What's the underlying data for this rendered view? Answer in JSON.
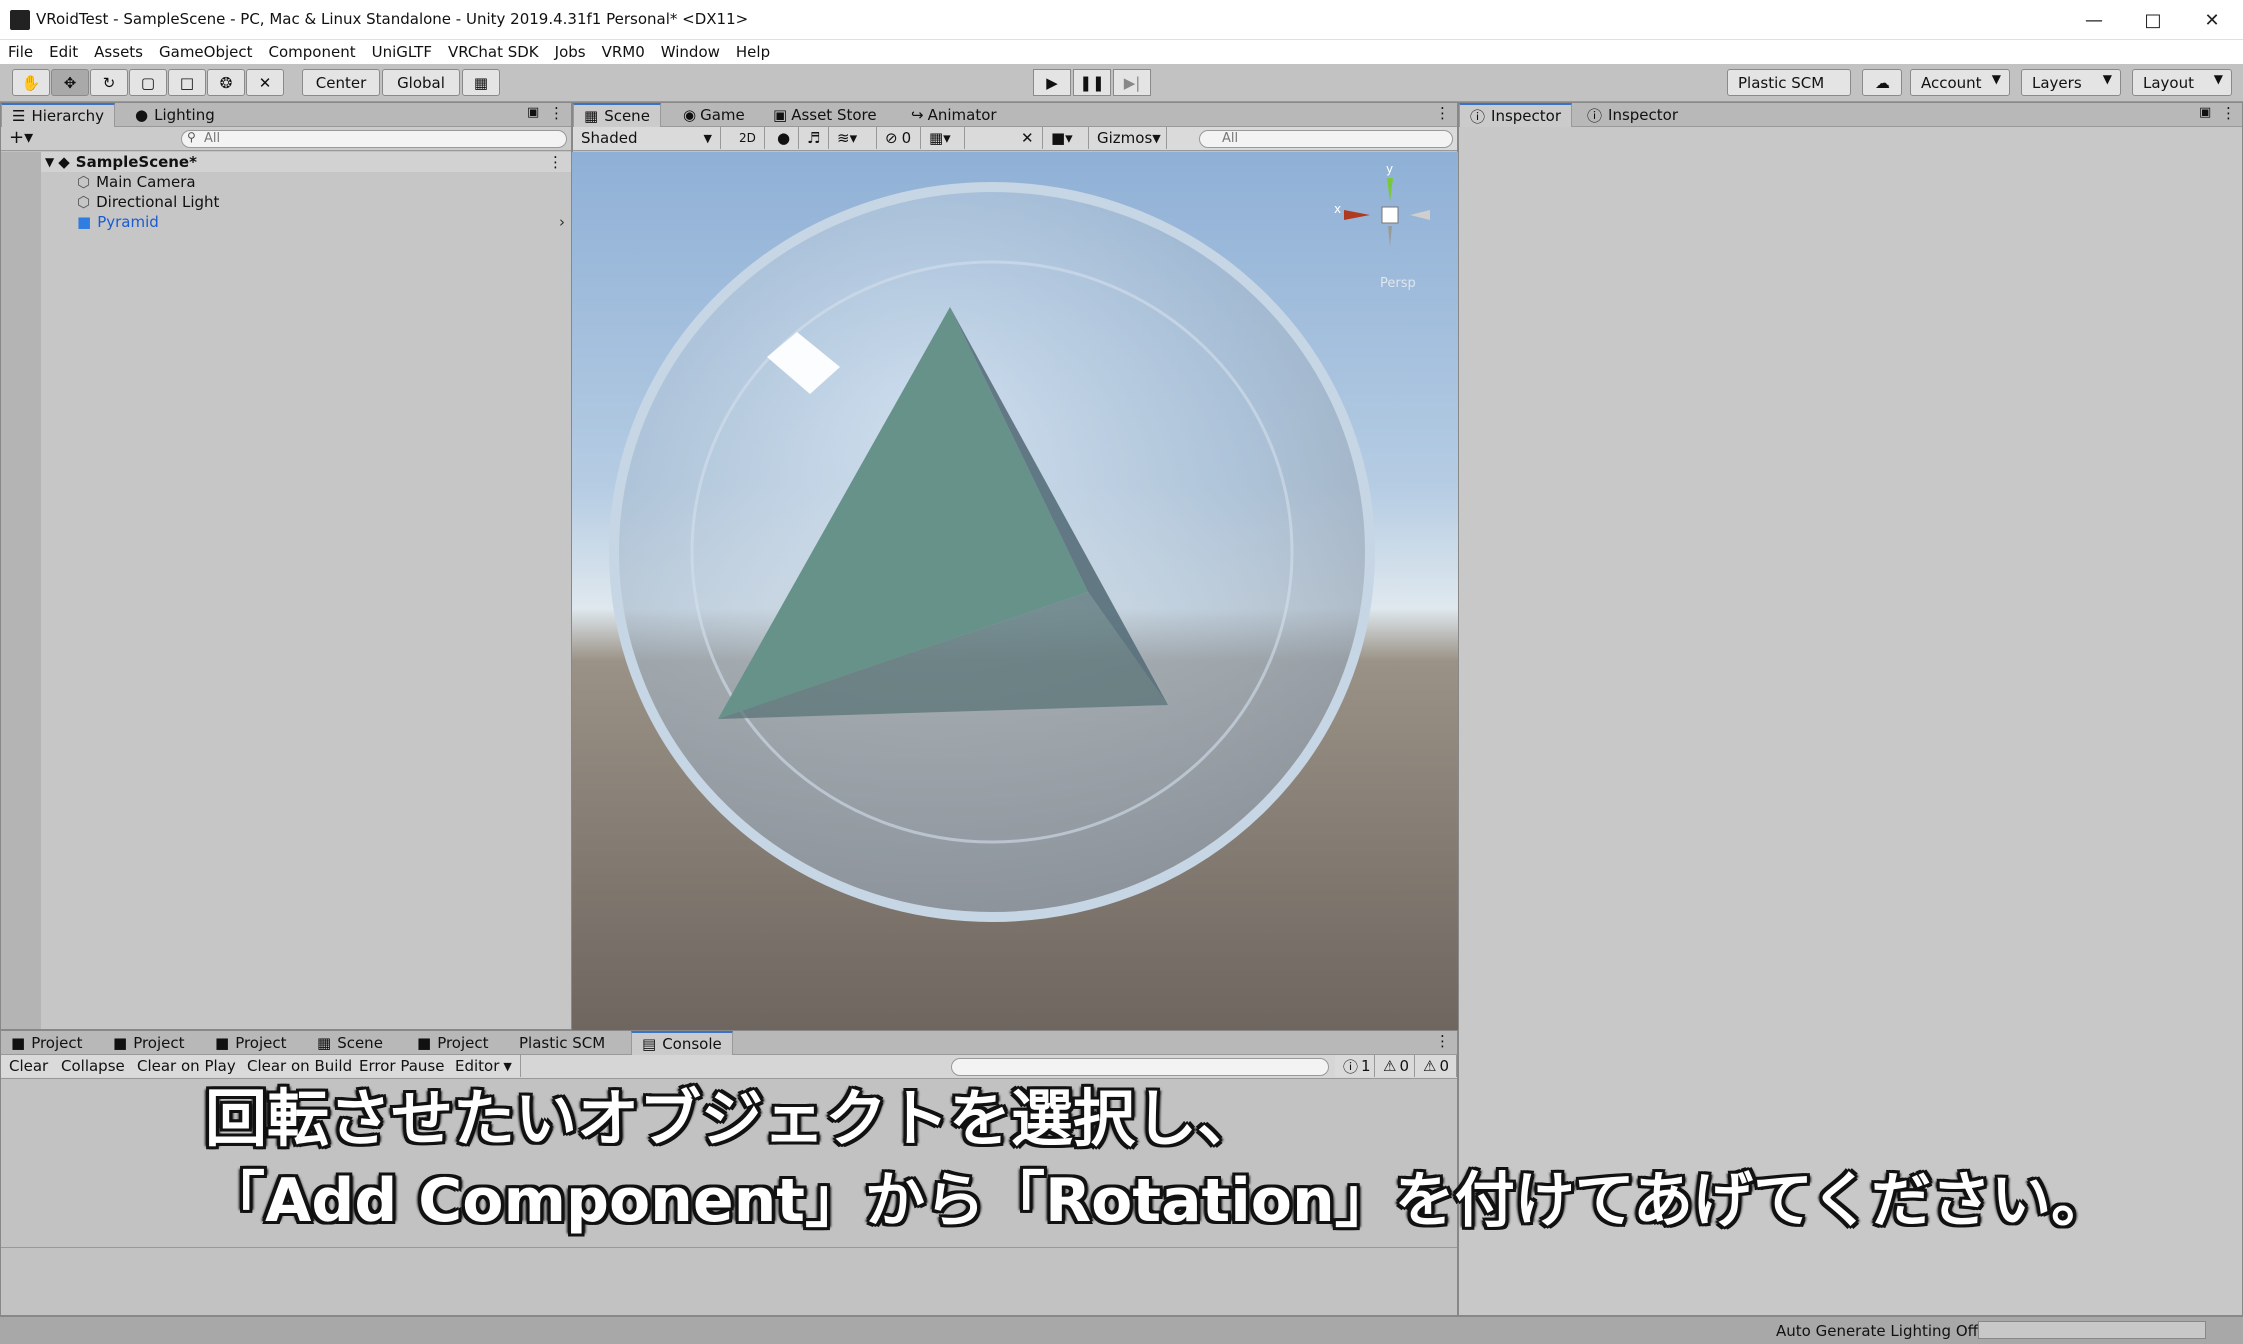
{
  "window": {
    "title": "VRoidTest - SampleScene - PC, Mac & Linux Standalone - Unity 2019.4.31f1 Personal* <DX11>"
  },
  "menu": [
    "File",
    "Edit",
    "Assets",
    "GameObject",
    "Component",
    "UniGLTF",
    "VRChat SDK",
    "Jobs",
    "VRM0",
    "Window",
    "Help"
  ],
  "toolbar": {
    "pivot_label": "Center",
    "space_label": "Global",
    "plastic_label": "Plastic SCM",
    "account_label": "Account",
    "layers_label": "Layers",
    "layout_label": "Layout"
  },
  "hierarchy": {
    "tabs": [
      "Hierarchy",
      "Lighting"
    ],
    "search_placeholder": "All",
    "scene_name": "SampleScene*",
    "items": [
      "Main Camera",
      "Directional Light",
      "Pyramid"
    ]
  },
  "scene": {
    "tabs": [
      "Scene",
      "Game",
      "Asset Store",
      "Animator"
    ],
    "shading_mode": "Shaded",
    "mode_2d": "2D",
    "effects_count": "0",
    "gizmos_label": "Gizmos",
    "search_placeholder": "All",
    "axis_y": "y",
    "axis_x": "x",
    "persp_label": "Persp"
  },
  "inspector": {
    "tabs": [
      "Inspector",
      "Inspector"
    ]
  },
  "bottom": {
    "tabs": [
      "Project",
      "Project",
      "Project",
      "Scene",
      "Project",
      "Plastic SCM",
      "Console"
    ],
    "console_buttons": [
      "Clear",
      "Collapse",
      "Clear on Play",
      "Clear on Build",
      "Error Pause",
      "Editor"
    ],
    "log_count": "1",
    "warn_count": "0",
    "error_count": "0"
  },
  "caption": {
    "line1": "回転させたいオブジェクトを選択し、",
    "line2": "「Add Component」から「Rotation」を付けてあげてください。"
  },
  "status": {
    "lighting": "Auto Generate Lighting Off"
  }
}
